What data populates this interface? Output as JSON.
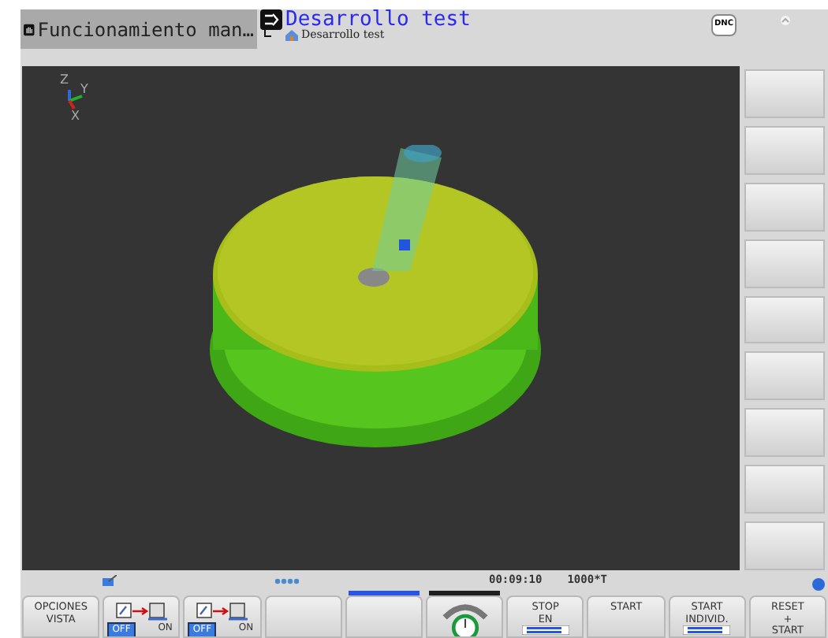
{
  "header": {
    "mode_tab": {
      "label": "Funcionamiento man…",
      "selected": false
    },
    "program_tab": {
      "title": "Desarrollo test",
      "subtitle": "Desarrollo test",
      "selected": true
    },
    "dnc_label": "DNC"
  },
  "status_bar": {
    "time": "00:09:10",
    "factor": "1000*T"
  },
  "axes": {
    "z": "Z",
    "y": "Y",
    "x": "X"
  },
  "softkeys": [
    {
      "kind": "text",
      "lines": [
        "OPCIONES",
        "VISTA"
      ]
    },
    {
      "kind": "toggle",
      "off": "OFF",
      "on_label": "ON",
      "on": false
    },
    {
      "kind": "toggle",
      "off": "OFF",
      "on_label": "ON",
      "on": false
    },
    {
      "kind": "blank"
    },
    {
      "kind": "blank",
      "color": "#2a55e0"
    },
    {
      "kind": "dial",
      "color": "#202020"
    },
    {
      "kind": "text_icon",
      "lines": [
        "STOP",
        "EN"
      ]
    },
    {
      "kind": "text",
      "lines": [
        "START"
      ]
    },
    {
      "kind": "text_icon",
      "lines": [
        "START",
        "INDIVID."
      ]
    },
    {
      "kind": "text",
      "lines": [
        "RESET",
        "+",
        "START"
      ]
    }
  ]
}
